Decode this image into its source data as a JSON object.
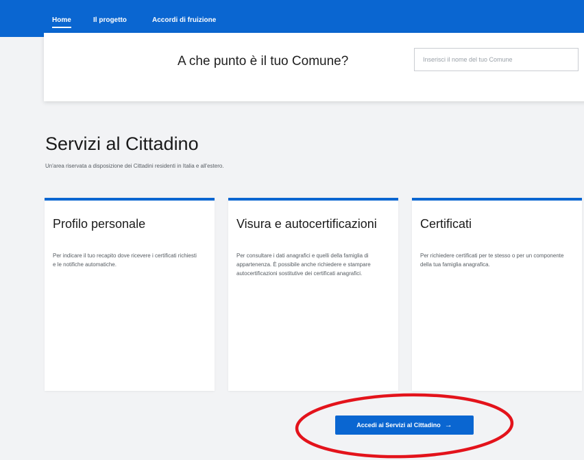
{
  "nav": {
    "items": [
      "Home",
      "Il progetto",
      "Accordi di fruizione"
    ]
  },
  "search": {
    "title": "A che punto è il tuo Comune?",
    "placeholder": "Inserisci il nome del tuo Comune"
  },
  "section": {
    "title": "Servizi al Cittadino",
    "subtitle": "Un'area riservata a disposizione dei Cittadini residenti in Italia e all'estero."
  },
  "cards": [
    {
      "title": "Profilo personale",
      "text": "Per indicare il tuo recapito dove ricevere i certificati richiesti e le notifiche automatiche."
    },
    {
      "title": "Visura e autocertificazioni",
      "text": "Per consultare i dati anagrafici e quelli della famiglia di appartenenza. È possibile anche richiedere e stampare autocertificazioni sostitutive dei certificati anagrafici."
    },
    {
      "title": "Certificati",
      "text": "Per richiedere certificati per te stesso o per un componente della tua famiglia anagrafica."
    }
  ],
  "cta": {
    "label": "Accedi ai Servizi al Cittadino",
    "icon": "arrow-right-icon",
    "arrow": "→"
  },
  "colors": {
    "primary": "#0a66d1",
    "annotation": "#e3131b",
    "background": "#f2f3f5"
  }
}
